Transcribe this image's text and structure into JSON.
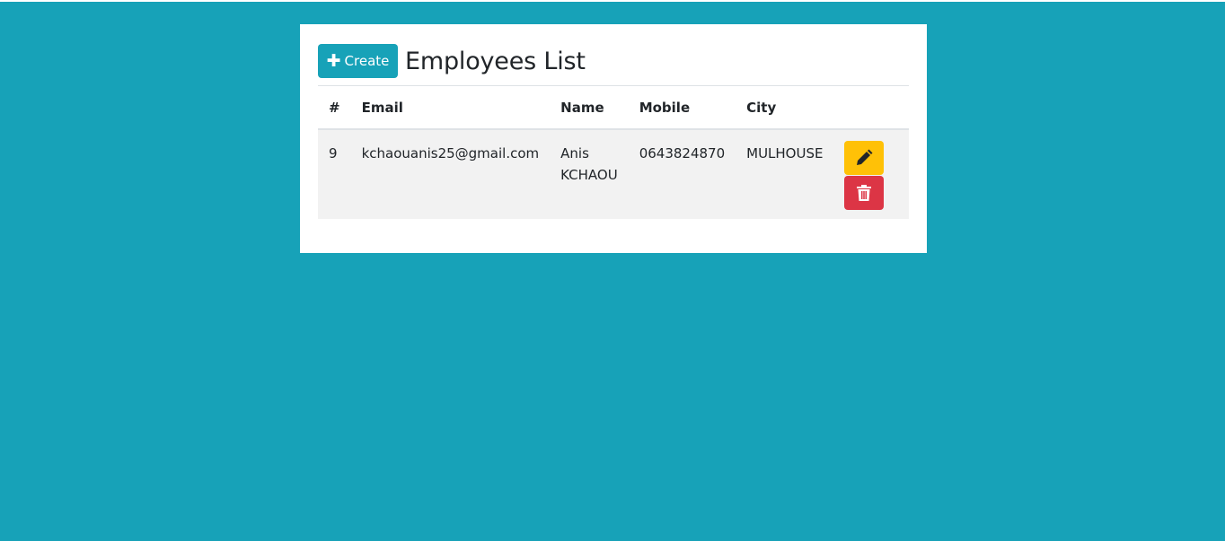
{
  "header": {
    "create_label": "Create",
    "title": "Employees List"
  },
  "table": {
    "columns": [
      "#",
      "Email",
      "Name",
      "Mobile",
      "City"
    ],
    "rows": [
      {
        "id": "9",
        "email": "kchaouanis25@gmail.com",
        "name": "Anis KCHAOU",
        "mobile": "0643824870",
        "city": "MULHOUSE"
      }
    ]
  },
  "icons": {
    "create": "plus-icon",
    "edit": "pencil-icon",
    "delete": "trash-icon"
  },
  "colors": {
    "background": "#17a2b8",
    "primary": "#17a2b8",
    "edit": "#ffc107",
    "delete": "#dc3545"
  }
}
